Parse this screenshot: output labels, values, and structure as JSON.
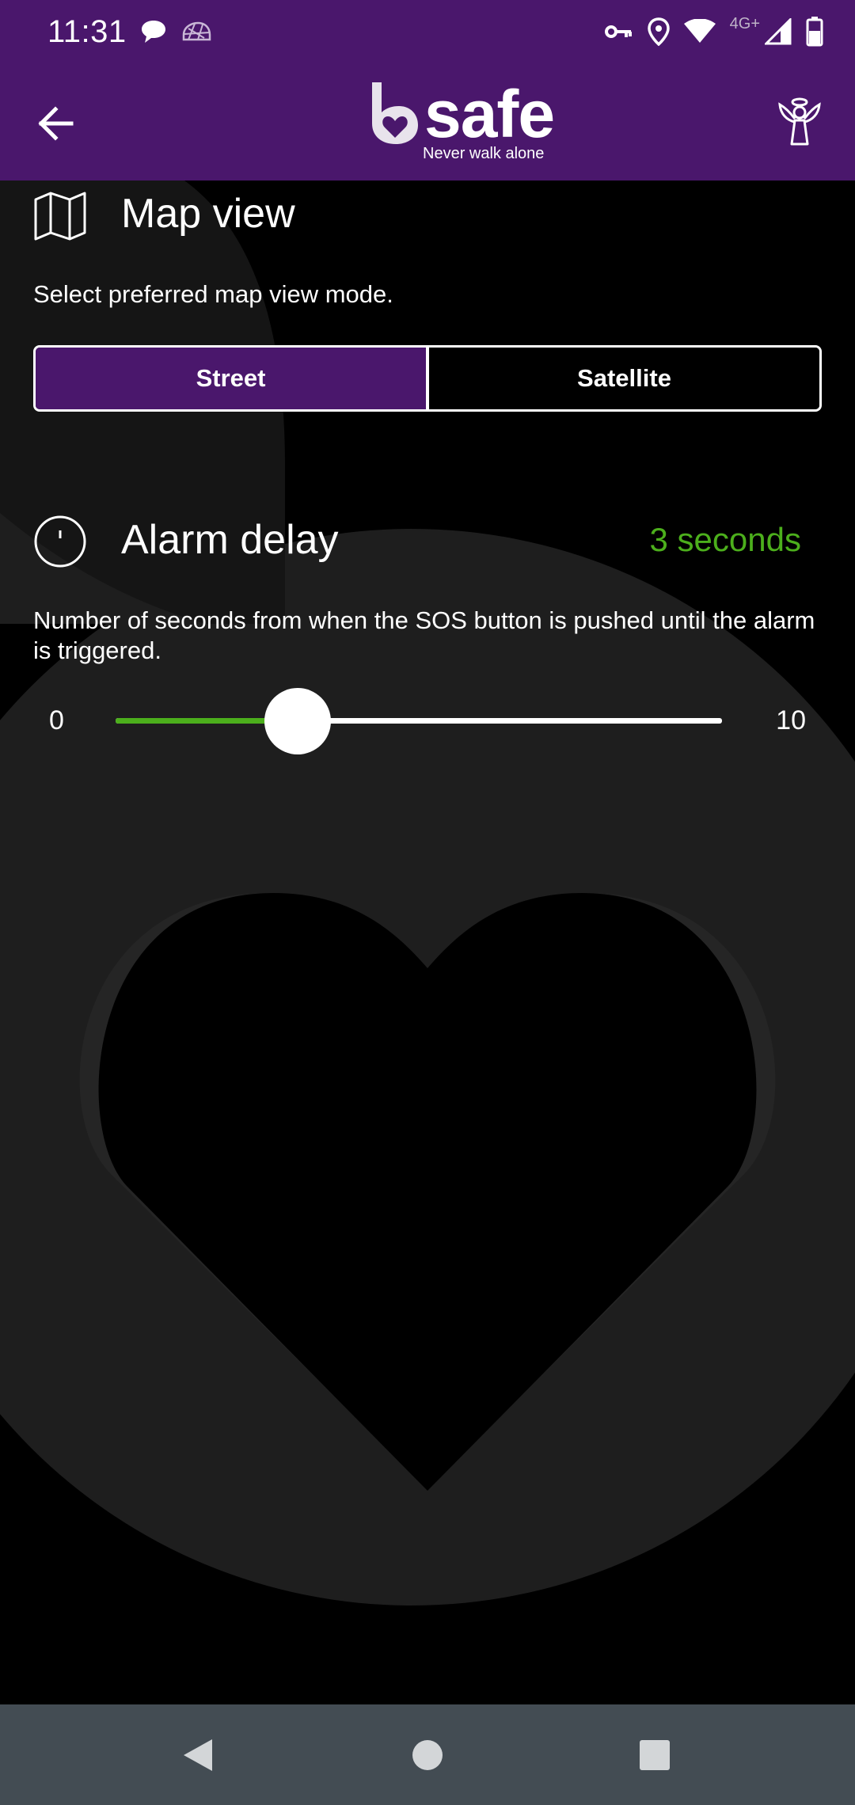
{
  "status_bar": {
    "time": "11:31",
    "network_label": "4G+",
    "left_icons": [
      "chat-bubble-icon",
      "mesh-notification-icon"
    ],
    "right_icons": [
      "vpn-key-icon",
      "location-pin-icon",
      "wifi-icon",
      "cell-signal-icon",
      "battery-icon"
    ]
  },
  "app_bar": {
    "logo_text": "safe",
    "logo_tagline": "Never walk alone",
    "back_icon": "arrow-back-icon",
    "guardian_icon": "angel-icon"
  },
  "map_view": {
    "icon": "map-icon",
    "title": "Map view",
    "description": "Select preferred map view mode.",
    "options": [
      "Street",
      "Satellite"
    ],
    "selected": "Street"
  },
  "alarm_delay": {
    "icon": "timer-icon",
    "title": "Alarm delay",
    "value_label": "3 seconds",
    "description": "Number of seconds from when the SOS button is pushed until the alarm is triggered.",
    "slider": {
      "min_label": "0",
      "max_label": "10",
      "min": 0,
      "max": 10,
      "value": 3
    }
  },
  "colors": {
    "brand_purple": "#4a176c",
    "accent_green": "#4caf1c",
    "nav_bar": "#434c53"
  },
  "nav_bar": {
    "buttons": [
      "back-triangle-icon",
      "home-circle-icon",
      "recents-square-icon"
    ]
  }
}
